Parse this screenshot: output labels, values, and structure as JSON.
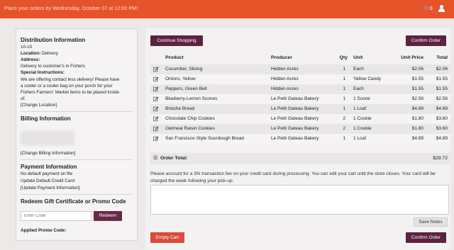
{
  "topbar": {
    "message": "Place your orders by Wednesday, October 07 at 12:00 PM!",
    "cart_count": "0"
  },
  "sidebar": {
    "distribution_heading": "Distribution Information",
    "distribution_code": "10-10",
    "location_label": "Location:",
    "location_value": " Delivery",
    "address_label": "Address:",
    "address_value": "Delivery to customer's in Fishers",
    "instructions_label": "Special Instructions:",
    "instructions_lines": [
      "We are offering contact less delivery! Please have",
      "a cooler or a cooler bag on your porch for your",
      "Fishers Farmers' Market items to be placed inside",
      "of."
    ],
    "change_location": "[Change Location]",
    "billing_heading": "Billing Information",
    "change_billing": "[Change Billing Information]",
    "payment_heading": "Payment Information",
    "payment_default": "No default payment on file",
    "update_card": "Update Default Credit Card",
    "update_payment": "[Update Payment Information]",
    "promo_heading": "Redeem Gift Certificate or Promo Code",
    "promo_placeholder": "Enter Code",
    "redeem_label": "Redeem",
    "applied_promo": "Applied Promo Code:"
  },
  "main": {
    "continue_label": "Continue Shopping",
    "confirm_label": "Confirm Order",
    "columns": [
      "Product",
      "Producer",
      "Qty",
      "Unit",
      "Unit Price",
      "Total"
    ],
    "items": [
      {
        "product": "Cucumber, Slicing",
        "producer": "Hidden Acres",
        "qty": "1",
        "unit": "Each",
        "price": "$2.06",
        "total": "$2.06"
      },
      {
        "product": "Onions, Yellow",
        "producer": "Hidden Acres",
        "qty": "1",
        "unit": "Yellow Candy",
        "price": "$1.55",
        "total": "$1.55"
      },
      {
        "product": "Peppers, Green Bell",
        "producer": "Hidden Acres",
        "qty": "1",
        "unit": "Each",
        "price": "$1.55",
        "total": "$1.55"
      },
      {
        "product": "Blueberry-Lemon Scones",
        "producer": "Le Petit Gateau Bakery",
        "qty": "1",
        "unit": "1 Scone",
        "price": "$2.58",
        "total": "$2.58"
      },
      {
        "product": "Brioche Bread",
        "producer": "Le Petit Gateau Bakery",
        "qty": "1",
        "unit": "1 Loaf",
        "price": "$4.89",
        "total": "$4.89"
      },
      {
        "product": "Chocolate Chip Cookies",
        "producer": "Le Petit Gateau Bakery",
        "qty": "2",
        "unit": "1 Cookie",
        "price": "$1.80",
        "total": "$3.60"
      },
      {
        "product": "Oatmeal Raisin Cookies",
        "producer": "Le Petit Gateau Bakery",
        "qty": "2",
        "unit": "1 Cookie",
        "price": "$1.80",
        "total": "$3.60"
      },
      {
        "product": "San Francisco-Style Sourdough Bread",
        "producer": "Le Petit Gateau Bakery",
        "qty": "1",
        "unit": "1 Loaf",
        "price": "$4.89",
        "total": "$4.89"
      }
    ],
    "order_total_label": "Order Total:",
    "order_total": "$29.72",
    "notice": "Please account for a 3% transaction fee on your credit card during processing. You can edit your cart until the store closes. Your card will be charged the week following your pick-up.",
    "save_notes_label": "Save Notes",
    "empty_cart_label": "Empty Cart",
    "confirm_bottom_label": "Confirm Order"
  },
  "colors": {
    "topbar": "#e5532b",
    "button_primary": "#5c2242",
    "button_danger": "#d94b3a"
  }
}
